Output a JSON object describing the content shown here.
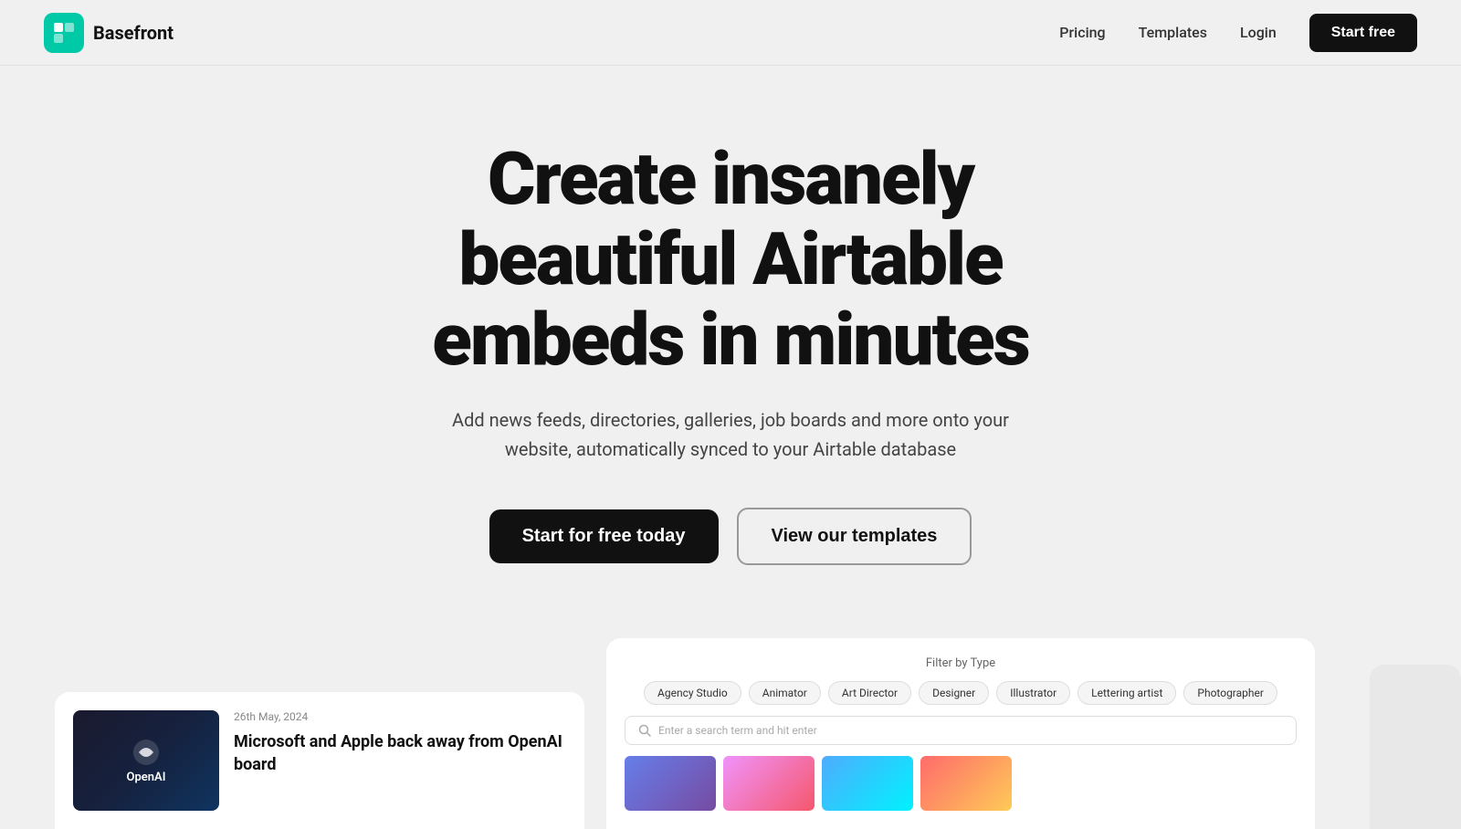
{
  "brand": {
    "name": "Basefront",
    "logo_bg": "#00c9a7"
  },
  "nav": {
    "pricing": "Pricing",
    "templates": "Templates",
    "login": "Login",
    "cta": "Start free"
  },
  "hero": {
    "title_line1": "Create insanely",
    "title_line2": "beautiful Airtable",
    "title_line3": "embeds in minutes",
    "subtitle": "Add news feeds, directories, galleries, job boards and more onto your website, automatically synced to your Airtable database",
    "btn_primary": "Start for free today",
    "btn_secondary": "View our templates"
  },
  "preview_news": {
    "date": "26th May, 2024",
    "headline": "Microsoft and Apple back away from OpenAI board",
    "image_label": "OpenAI"
  },
  "preview_directory": {
    "filter_label": "Filter by Type",
    "tags": [
      "Agency Studio",
      "Animator",
      "Art Director",
      "Designer",
      "Illustrator",
      "Lettering artist",
      "Photographer"
    ],
    "search_placeholder": "Enter a search term and hit enter",
    "photographer_label": "Photographer"
  },
  "colors": {
    "accent_green": "#00c9a7",
    "bg_main": "#f0f0f0",
    "text_dark": "#111111",
    "text_mid": "#444444",
    "btn_dark_bg": "#111111",
    "btn_dark_text": "#ffffff"
  }
}
